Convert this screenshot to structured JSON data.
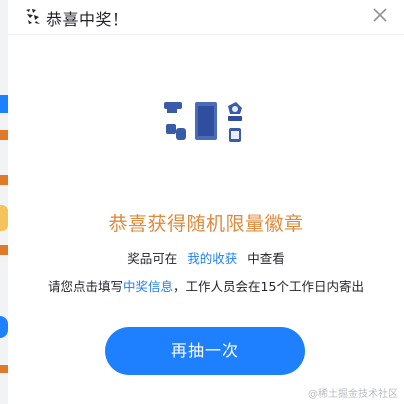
{
  "modal": {
    "title": "恭喜中奖！",
    "close_label": "×",
    "headline": "恭喜获得随机限量徽章",
    "line1": {
      "prefix": "奖品可在",
      "link": "我的收获",
      "suffix": "中查看"
    },
    "line2": {
      "prefix": "请您点击填写",
      "link": "中奖信息",
      "suffix": "，工作人员会在15个工作日内寄出"
    },
    "button_label": "再抽一次"
  },
  "watermark": "@稀土掘金技术社区",
  "colors": {
    "accent": "#1e80ff",
    "headline": "#e08a3c",
    "badge": "#3a5ba8"
  },
  "icons": {
    "title": "celebration-icon",
    "close": "close-icon",
    "prize": "badge-set-image"
  }
}
